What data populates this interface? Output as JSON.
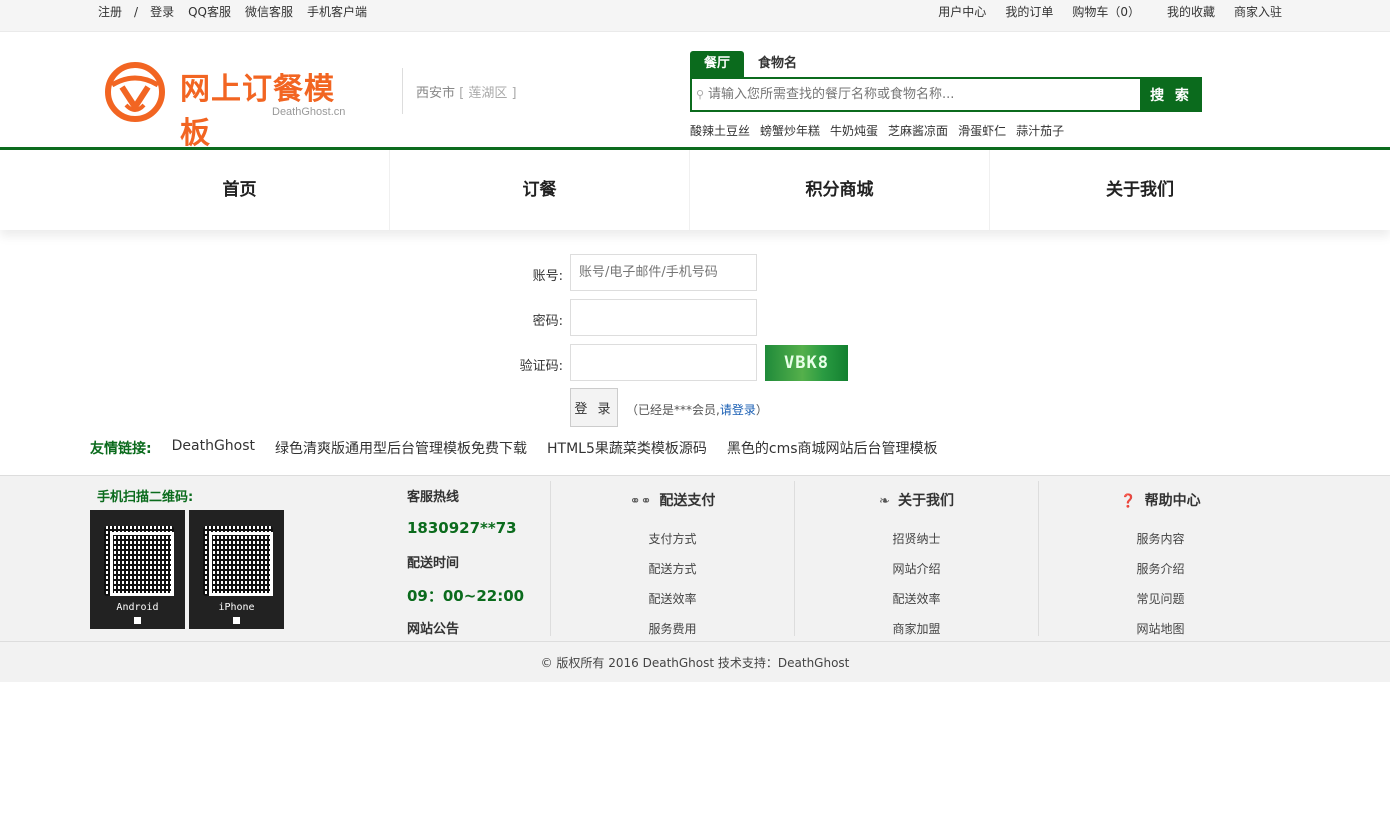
{
  "topbar": {
    "left": [
      "注册",
      "/",
      "登录",
      "QQ客服",
      "微信客服",
      "手机客户端"
    ],
    "right": [
      "用户中心",
      "我的订单",
      "购物车（0）",
      "我的收藏",
      "商家入驻"
    ]
  },
  "header": {
    "logo_text": "网上订餐模板",
    "logo_sub": "DeathGhost.cn",
    "city": "西安市",
    "area": "[ 莲湖区 ]",
    "search_tabs": [
      "餐厅",
      "食物名"
    ],
    "search_placeholder": "请输入您所需查找的餐厅名称或食物名称...",
    "search_button": "搜 索",
    "hot_keywords": [
      "酸辣土豆丝",
      "螃蟹炒年糕",
      "牛奶炖蛋",
      "芝麻酱凉面",
      "滑蛋虾仁",
      "蒜汁茄子"
    ]
  },
  "nav": [
    "首页",
    "订餐",
    "积分商城",
    "关于我们"
  ],
  "login": {
    "account_label": "账号:",
    "account_placeholder": "账号/电子邮件/手机号码",
    "password_label": "密码:",
    "captcha_label": "验证码:",
    "captcha_text": "VBK8",
    "submit": "登 录",
    "tip_prefix": "（已经是***会员,",
    "tip_link": "请登录",
    "tip_suffix": "）"
  },
  "friends": {
    "title": "友情链接:",
    "links": [
      "DeathGhost",
      "绿色清爽版通用型后台管理模板免费下载",
      "HTML5果蔬菜类模板源码",
      "黑色的cms商城网站后台管理模板"
    ]
  },
  "footer": {
    "qr_title": "手机扫描二维码:",
    "qr_labels": [
      "Android",
      "iPhone"
    ],
    "hotline_title": "客服热线",
    "hotline": "1830927**73",
    "time_title": "配送时间",
    "time": "09：00~22:00",
    "notice_title": "网站公告",
    "columns": [
      {
        "title": "配送支付",
        "icon": "bicycle-icon",
        "items": [
          "支付方式",
          "配送方式",
          "配送效率",
          "服务费用"
        ]
      },
      {
        "title": "关于我们",
        "icon": "leaf-icon",
        "items": [
          "招贤纳士",
          "网站介绍",
          "配送效率",
          "商家加盟"
        ]
      },
      {
        "title": "帮助中心",
        "icon": "question-icon",
        "items": [
          "服务内容",
          "服务介绍",
          "常见问题",
          "网站地图"
        ]
      }
    ],
    "copyright": "© 版权所有 2016 DeathGhost 技术支持：DeathGhost"
  },
  "colors": {
    "brand_green": "#0b6b1d",
    "logo_orange": "#f26522"
  }
}
